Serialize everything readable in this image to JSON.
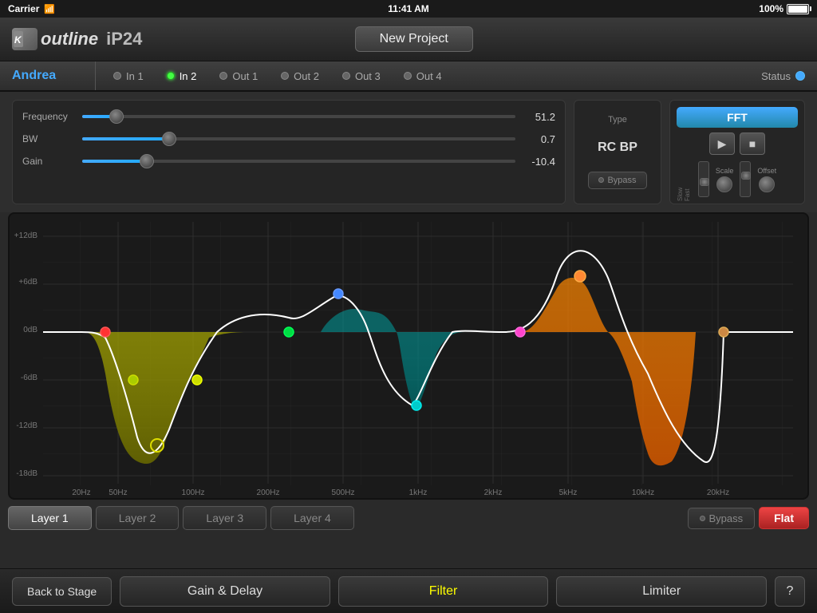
{
  "statusBar": {
    "carrier": "Carrier",
    "time": "11:41 AM",
    "battery": "100%"
  },
  "header": {
    "logoText": "iP24",
    "projectName": "New Project"
  },
  "channelTabs": {
    "channelName": "Andrea",
    "tabs": [
      {
        "label": "In 1",
        "dotState": "gray",
        "active": false
      },
      {
        "label": "In 2",
        "dotState": "green",
        "active": true
      },
      {
        "label": "Out 1",
        "dotState": "gray",
        "active": false
      },
      {
        "label": "Out 2",
        "dotState": "gray",
        "active": false
      },
      {
        "label": "Out 3",
        "dotState": "gray",
        "active": false
      },
      {
        "label": "Out 4",
        "dotState": "gray",
        "active": false
      }
    ],
    "statusLabel": "Status"
  },
  "controls": {
    "sliders": [
      {
        "label": "Frequency",
        "value": "51.2",
        "fillPct": 8
      },
      {
        "label": "BW",
        "value": "0.7",
        "fillPct": 20
      },
      {
        "label": "Gain",
        "value": "-10.4",
        "fillPct": 15
      }
    ],
    "type": {
      "label": "Type",
      "value": "RC BP",
      "bypassLabel": "Bypass"
    },
    "fft": {
      "buttonLabel": "FFT",
      "playIcon": "▶",
      "stopIcon": "■",
      "sliders": [
        {
          "label": "Slow-Fast"
        },
        {
          "label": "Scale"
        },
        {
          "label": "Offset"
        }
      ]
    }
  },
  "eqChart": {
    "yLabels": [
      "+12dB",
      "+6dB",
      "0dB",
      "-6dB",
      "-12dB",
      "-18dB"
    ],
    "xLabels": [
      "20Hz",
      "50Hz",
      "100Hz",
      "200Hz",
      "500Hz",
      "1kHz",
      "2kHz",
      "5kHz",
      "10kHz",
      "20kHz"
    ],
    "points": [
      {
        "color": "#ff3333",
        "x": 15,
        "y": 46,
        "label": "red-point"
      },
      {
        "color": "#aacc00",
        "x": 18,
        "y": 61,
        "label": "yellow-green-point-left"
      },
      {
        "color": "#ccdd00",
        "x": 26,
        "y": 61,
        "label": "yellow-green-point-right"
      },
      {
        "color": "#dddd00",
        "x": 23,
        "y": 70,
        "label": "yellow-center-point"
      },
      {
        "color": "#00cc44",
        "x": 38,
        "y": 46,
        "label": "green-point"
      },
      {
        "color": "#4488ff",
        "x": 45,
        "y": 40,
        "label": "blue-point"
      },
      {
        "color": "#00cccc",
        "x": 50,
        "y": 63,
        "label": "cyan-point"
      },
      {
        "color": "#ff44cc",
        "x": 63,
        "y": 46,
        "label": "pink-point"
      },
      {
        "color": "#ff8833",
        "x": 72,
        "y": 30,
        "label": "orange-point"
      },
      {
        "color": "#cc8844",
        "x": 88,
        "y": 46,
        "label": "brown-point"
      }
    ]
  },
  "layerTabs": {
    "tabs": [
      {
        "label": "Layer 1",
        "active": true
      },
      {
        "label": "Layer 2",
        "active": false
      },
      {
        "label": "Layer 3",
        "active": false
      },
      {
        "label": "Layer 4",
        "active": false
      }
    ],
    "bypassLabel": "Bypass",
    "flatLabel": "Flat"
  },
  "bottomNav": {
    "backLabel": "Back to Stage",
    "gainDelayLabel": "Gain & Delay",
    "filterLabel": "Filter",
    "limiterLabel": "Limiter",
    "helpIcon": "?"
  }
}
